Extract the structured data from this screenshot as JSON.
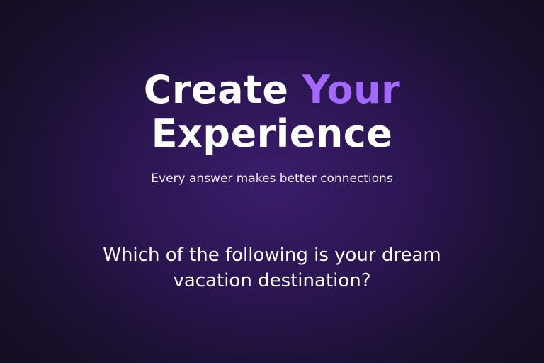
{
  "hero": {
    "title_part1": "Create",
    "title_accent": "Your",
    "title_line2": "Experience",
    "subtitle": "Every answer makes better connections"
  },
  "quiz": {
    "question": "Which of the following is your dream vacation destination?"
  },
  "colors": {
    "background": "#2a1550",
    "accent": "#a268ff",
    "text": "#ffffff"
  }
}
